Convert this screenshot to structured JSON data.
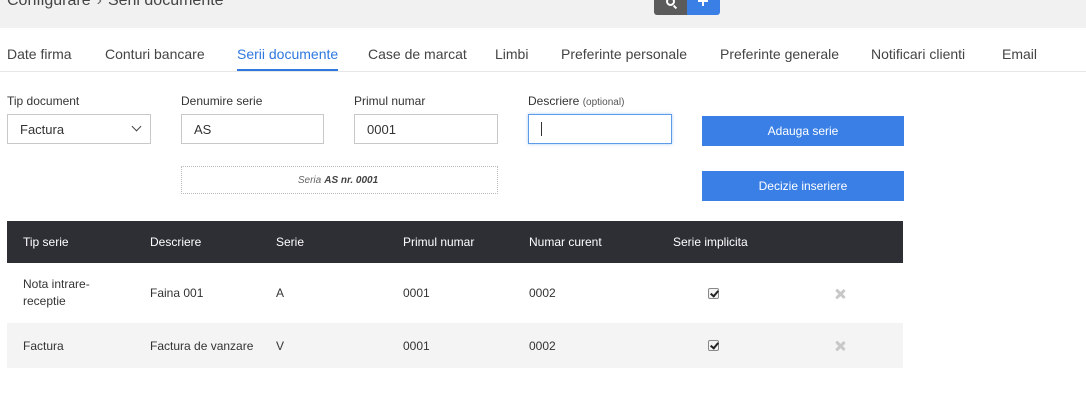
{
  "breadcrumb": {
    "parent": "Configurare",
    "separator": "›",
    "current": "Serii documente"
  },
  "topbar": {
    "search_icon": "search-icon",
    "add_icon": "plus-icon"
  },
  "tabs": [
    {
      "label": "Date firma"
    },
    {
      "label": "Conturi bancare"
    },
    {
      "label": "Serii documente",
      "active": true
    },
    {
      "label": "Case de marcat"
    },
    {
      "label": "Limbi"
    },
    {
      "label": "Preferinte personale"
    },
    {
      "label": "Preferinte generale"
    },
    {
      "label": "Notificari clienti"
    },
    {
      "label": "Email"
    }
  ],
  "form": {
    "tip_document": {
      "label": "Tip document",
      "value": "Factura"
    },
    "denumire_serie": {
      "label": "Denumire serie",
      "value": "AS"
    },
    "primul_numar": {
      "label": "Primul numar",
      "value": "0001"
    },
    "descriere": {
      "label": "Descriere",
      "label_note": "(optional)",
      "value": ""
    },
    "preview": {
      "prefix": "Seria",
      "series": "AS nr. 0001"
    },
    "add_button": "Adauga serie",
    "decision_button": "Decizie inseriere"
  },
  "table": {
    "headers": [
      "Tip serie",
      "Descriere",
      "Serie",
      "Primul numar",
      "Numar curent",
      "Serie implicita"
    ],
    "rows": [
      {
        "tip_serie": "Nota intrare-receptie",
        "descriere": "Faina 001",
        "serie": "A",
        "primul_numar": "0001",
        "numar_curent": "0002",
        "implicita": true
      },
      {
        "tip_serie": "Factura",
        "descriere": "Factura de vanzare",
        "serie": "V",
        "primul_numar": "0001",
        "numar_curent": "0002",
        "implicita": true
      }
    ]
  },
  "colors": {
    "accent": "#3a7fe6",
    "table_header": "#2d2f35",
    "topbar": "#f1f1f1"
  }
}
